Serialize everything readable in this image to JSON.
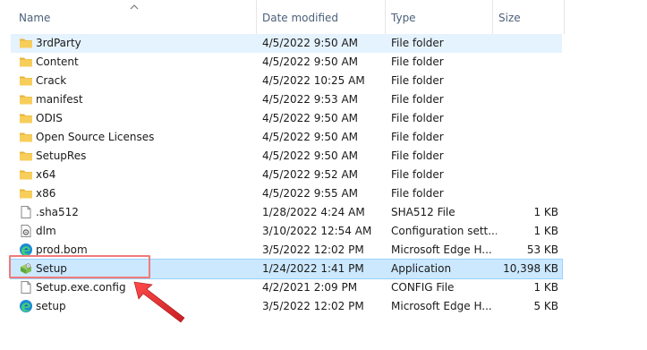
{
  "columns": {
    "name": "Name",
    "date": "Date modified",
    "type": "Type",
    "size": "Size"
  },
  "files": [
    {
      "name": "3rdParty",
      "date": "4/5/2022 9:50 AM",
      "type": "File folder",
      "size": "",
      "icon": "folder-icon"
    },
    {
      "name": "Content",
      "date": "4/5/2022 9:50 AM",
      "type": "File folder",
      "size": "",
      "icon": "folder-icon"
    },
    {
      "name": "Crack",
      "date": "4/5/2022 10:25 AM",
      "type": "File folder",
      "size": "",
      "icon": "folder-icon"
    },
    {
      "name": "manifest",
      "date": "4/5/2022 9:53 AM",
      "type": "File folder",
      "size": "",
      "icon": "folder-icon"
    },
    {
      "name": "ODIS",
      "date": "4/5/2022 9:50 AM",
      "type": "File folder",
      "size": "",
      "icon": "folder-icon"
    },
    {
      "name": "Open Source Licenses",
      "date": "4/5/2022 9:50 AM",
      "type": "File folder",
      "size": "",
      "icon": "folder-icon"
    },
    {
      "name": "SetupRes",
      "date": "4/5/2022 9:50 AM",
      "type": "File folder",
      "size": "",
      "icon": "folder-icon"
    },
    {
      "name": "x64",
      "date": "4/5/2022 9:52 AM",
      "type": "File folder",
      "size": "",
      "icon": "folder-icon"
    },
    {
      "name": "x86",
      "date": "4/5/2022 9:55 AM",
      "type": "File folder",
      "size": "",
      "icon": "folder-icon"
    },
    {
      "name": ".sha512",
      "date": "1/28/2022 4:24 AM",
      "type": "SHA512 File",
      "size": "1 KB",
      "icon": "document-icon"
    },
    {
      "name": "dlm",
      "date": "3/10/2022 12:54 AM",
      "type": "Configuration sett...",
      "size": "1 KB",
      "icon": "config-file-icon"
    },
    {
      "name": "prod.bom",
      "date": "3/5/2022 12:02 PM",
      "type": "Microsoft Edge H...",
      "size": "53 KB",
      "icon": "edge-icon"
    },
    {
      "name": "Setup",
      "date": "1/24/2022 1:41 PM",
      "type": "Application",
      "size": "10,398 KB",
      "icon": "setup-app-icon"
    },
    {
      "name": "Setup.exe.config",
      "date": "4/2/2021 2:09 PM",
      "type": "CONFIG File",
      "size": "1 KB",
      "icon": "document-icon"
    },
    {
      "name": "setup",
      "date": "3/5/2022 12:02 PM",
      "type": "Microsoft Edge H...",
      "size": "5 KB",
      "icon": "edge-icon"
    }
  ],
  "hover_index": 0,
  "selected_index": 12,
  "colors": {
    "folder": "#f5c542",
    "selection": "#cce8ff",
    "hover": "#e5f3ff",
    "annotation": "#e8353a"
  }
}
